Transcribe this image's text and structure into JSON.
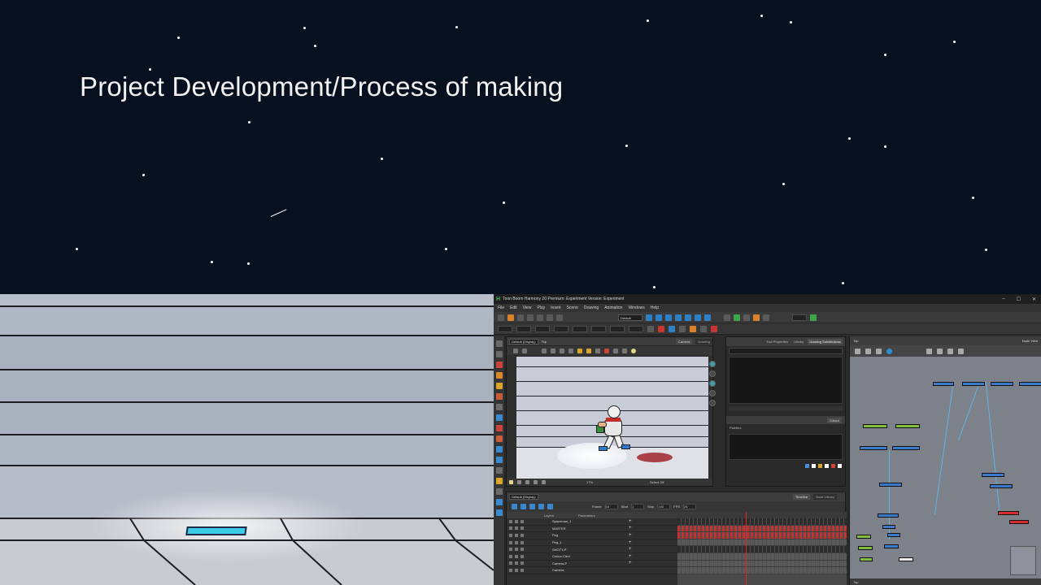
{
  "slide": {
    "title": "Project Development/Process  of making"
  },
  "app": {
    "window_title": "Toon Boom Harmony 20 Premium: Experiment Version: Experiment",
    "window_controls": [
      "–",
      "☐",
      "✕"
    ],
    "menu": [
      "File",
      "Edit",
      "View",
      "Play",
      "Insert",
      "Scene",
      "Drawing",
      "Animation",
      "Windows",
      "Help"
    ],
    "toolbar": {
      "default_select": "Default"
    },
    "camera_view": {
      "display_select": "Default (Display)",
      "path": "Top",
      "tabs": [
        "Camera",
        "Drawing"
      ],
      "zoom": "17%",
      "status": "Select Off"
    },
    "tool_properties": {
      "tabs": [
        "Tool Properties",
        "Library",
        "Drawing Substitutions"
      ]
    },
    "colour": {
      "tab": "Colour",
      "palettes_label": "Palettes"
    },
    "node_view": {
      "path": "Top",
      "tab": "Node View",
      "bottom_path": "Top"
    },
    "timeline": {
      "display_select": "Default (Display)",
      "tabs": [
        "Timeline",
        "Node Library"
      ],
      "frame_label": "Frame",
      "frame_value": "18",
      "start_label": "Start",
      "start_value": "1",
      "stop_label": "Stop",
      "stop_value": "140",
      "fps_label": "FPS",
      "fps_value": "24",
      "layers_header": "Layers",
      "parameters_header": "Parameters",
      "layers": [
        {
          "name": "Spaceman_1"
        },
        {
          "name": "MASTER"
        },
        {
          "name": "Peg"
        },
        {
          "name": "Peg_1"
        },
        {
          "name": "SHOTY-P"
        },
        {
          "name": "Colour-Card"
        },
        {
          "name": "Camera-P"
        },
        {
          "name": "Camera"
        }
      ]
    }
  },
  "colors": {
    "slide_bg": "#06101f",
    "accent_blue": "#3b79c9",
    "node_green": "#84bc44",
    "node_red": "#d22c2c",
    "playhead": "#e02a2a"
  }
}
